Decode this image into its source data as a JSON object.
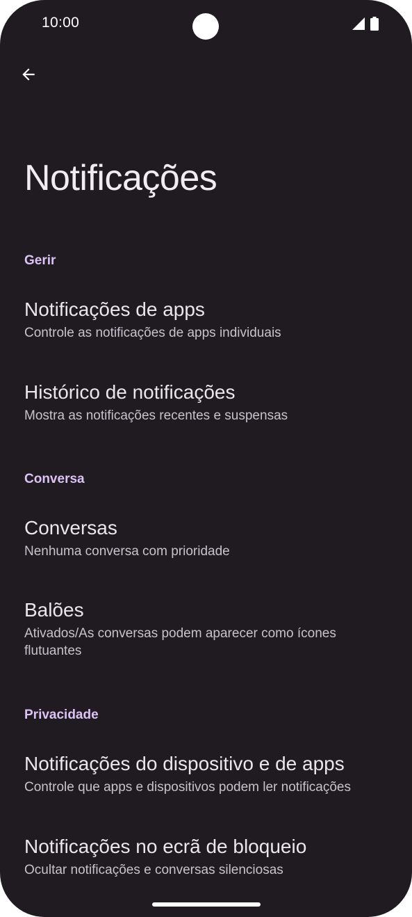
{
  "status_bar": {
    "time": "10:00",
    "icons": [
      "signal-icon",
      "battery-icon"
    ]
  },
  "header": {
    "back_icon": "arrow-back-icon",
    "title": "Notificações"
  },
  "sections": [
    {
      "header": "Gerir",
      "items": [
        {
          "title": "Notificações de apps",
          "subtitle": "Controle as notificações de apps individuais"
        },
        {
          "title": "Histórico de notificações",
          "subtitle": "Mostra as notificações recentes e suspensas"
        }
      ]
    },
    {
      "header": "Conversa",
      "items": [
        {
          "title": "Conversas",
          "subtitle": "Nenhuma conversa com prioridade"
        },
        {
          "title": "Balões",
          "subtitle": "Ativados/As conversas podem aparecer como ícones flutuantes"
        }
      ]
    },
    {
      "header": "Privacidade",
      "items": [
        {
          "title": "Notificações do dispositivo e de apps",
          "subtitle": "Controle que apps e dispositivos podem ler notificações"
        },
        {
          "title": "Notificações no ecrã de bloqueio",
          "subtitle": "Ocultar notificações e conversas silenciosas"
        }
      ]
    }
  ],
  "colors": {
    "background": "#1f1b21",
    "accent_header": "#ddc2f5",
    "title_text": "#ece5ee",
    "subtitle_text": "#c9c2cd"
  }
}
